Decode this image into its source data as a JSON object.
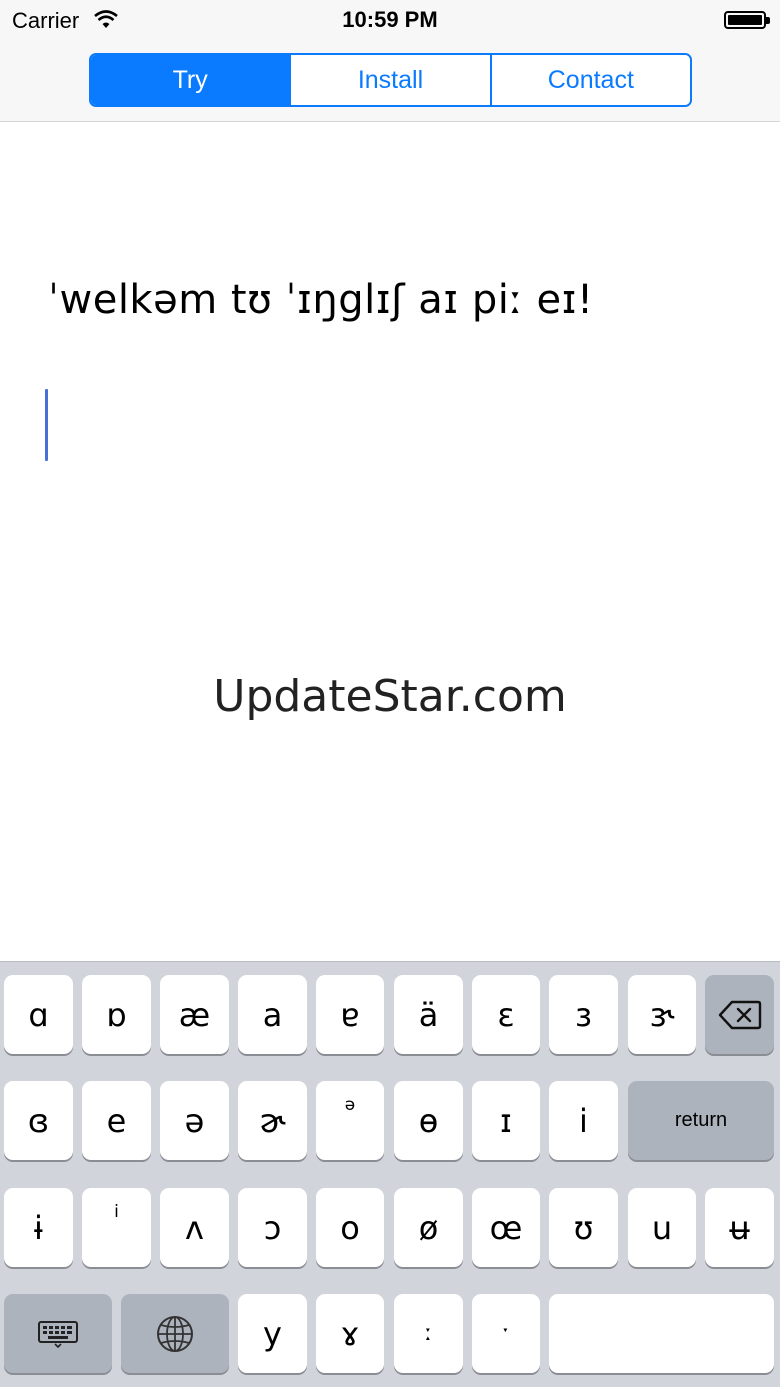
{
  "status_bar": {
    "carrier": "Carrier",
    "time": "10:59 PM"
  },
  "tabs": [
    {
      "label": "Try",
      "active": true
    },
    {
      "label": "Install",
      "active": false
    },
    {
      "label": "Contact",
      "active": false
    }
  ],
  "content": {
    "phonetic_text": "ˈwelkəm tʊ ˈɪŋglɪʃ aɪ piː eɪ!",
    "watermark": "UpdateStar.com"
  },
  "keyboard": {
    "row1": [
      "ɑ",
      "ɒ",
      "æ",
      "a",
      "ɐ",
      "ä",
      "ɛ",
      "ɜ",
      "ɝ"
    ],
    "row2": [
      "ɞ",
      "e",
      "ə",
      "ɚ",
      "ə",
      "ɵ",
      "ɪ",
      "i"
    ],
    "row3": [
      "ɨ",
      "i",
      "ʌ",
      "ɔ",
      "o",
      "ø",
      "œ",
      "ʊ",
      "u",
      "ʉ"
    ],
    "row4": [
      "y",
      "ɤ",
      "ː",
      "ˑ"
    ],
    "return_label": "return",
    "colors": {
      "accent": "#0a7aff",
      "key_bg": "#ffffff",
      "dark_key_bg": "#adb3bc",
      "keyboard_bg": "#d1d5db"
    }
  }
}
